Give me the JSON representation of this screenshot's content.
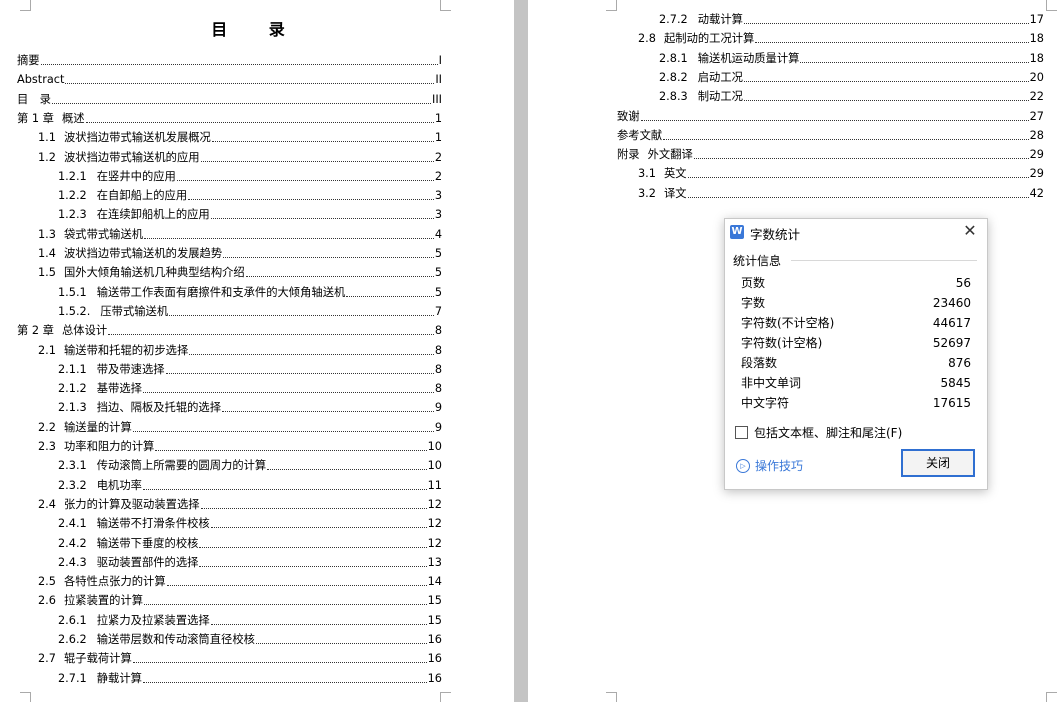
{
  "toc_title": "目 录",
  "left_entries": [
    {
      "num": "",
      "label": "摘要",
      "page": "I",
      "level": 0
    },
    {
      "num": "",
      "label": "Abstract",
      "page": "II",
      "level": 0
    },
    {
      "num": "",
      "label": "目　录",
      "page": "III",
      "level": 0
    },
    {
      "num": "第 1 章",
      "label": "概述",
      "page": "1",
      "level": 0
    },
    {
      "num": "1.1",
      "label": "波状挡边带式输送机发展概况",
      "page": "1",
      "level": 1
    },
    {
      "num": "1.2",
      "label": "波状挡边带式输送机的应用",
      "page": "2",
      "level": 1
    },
    {
      "num": "1.2.1",
      "label": "在竖井中的应用",
      "page": "2",
      "level": 2
    },
    {
      "num": "1.2.2",
      "label": "在自卸船上的应用",
      "page": "3",
      "level": 2
    },
    {
      "num": "1.2.3",
      "label": "在连续卸船机上的应用",
      "page": "3",
      "level": 2
    },
    {
      "num": "1.3",
      "label": "袋式带式输送机",
      "page": "4",
      "level": 1
    },
    {
      "num": "1.4",
      "label": "波状挡边带式输送机的发展趋势",
      "page": "5",
      "level": 1
    },
    {
      "num": "1.5",
      "label": "国外大倾角输送机几种典型结构介绍",
      "page": "5",
      "level": 1
    },
    {
      "num": "1.5.1",
      "label": "输送带工作表面有磨擦件和支承件的大倾角轴送机",
      "page": "5",
      "level": 2
    },
    {
      "num": "1.5.2.",
      "label": "压带式输送机",
      "page": "7",
      "level": 2
    },
    {
      "num": "第 2 章",
      "label": "总体设计",
      "page": "8",
      "level": 0
    },
    {
      "num": "2.1",
      "label": "输送带和托辊的初步选择",
      "page": "8",
      "level": 1
    },
    {
      "num": "2.1.1",
      "label": "带及带速选择",
      "page": "8",
      "level": 2
    },
    {
      "num": "2.1.2",
      "label": "基带选择",
      "page": "8",
      "level": 2
    },
    {
      "num": "2.1.3",
      "label": "挡边、隔板及托辊的选择",
      "page": "9",
      "level": 2
    },
    {
      "num": "2.2",
      "label": "输送量的计算",
      "page": "9",
      "level": 1
    },
    {
      "num": "2.3",
      "label": "功率和阻力的计算",
      "page": "10",
      "level": 1
    },
    {
      "num": "2.3.1",
      "label": "传动滚筒上所需要的圆周力的计算",
      "page": "10",
      "level": 2
    },
    {
      "num": "2.3.2",
      "label": "电机功率",
      "page": "11",
      "level": 2
    },
    {
      "num": "2.4",
      "label": "张力的计算及驱动装置选择",
      "page": "12",
      "level": 1
    },
    {
      "num": "2.4.1",
      "label": "输送带不打滑条件校核",
      "page": "12",
      "level": 2
    },
    {
      "num": "2.4.2",
      "label": "输送带下垂度的校核",
      "page": "12",
      "level": 2
    },
    {
      "num": "2.4.3",
      "label": "驱动装置部件的选择",
      "page": "13",
      "level": 2
    },
    {
      "num": "2.5",
      "label": "各特性点张力的计算",
      "page": "14",
      "level": 1
    },
    {
      "num": "2.6",
      "label": "拉紧装置的计算",
      "page": "15",
      "level": 1
    },
    {
      "num": "2.6.1",
      "label": "拉紧力及拉紧装置选择",
      "page": "15",
      "level": 2
    },
    {
      "num": "2.6.2",
      "label": "输送带层数和传动滚筒直径校核",
      "page": "16",
      "level": 2
    },
    {
      "num": "2.7",
      "label": "辊子载荷计算",
      "page": "16",
      "level": 1
    },
    {
      "num": "2.7.1",
      "label": "静载计算",
      "page": "16",
      "level": 2
    }
  ],
  "right_entries": [
    {
      "num": "2.7.2",
      "label": "动载计算",
      "page": "17",
      "level": 2
    },
    {
      "num": "2.8",
      "label": "起制动的工况计算",
      "page": "18",
      "level": 1
    },
    {
      "num": "2.8.1",
      "label": "输送机运动质量计算",
      "page": "18",
      "level": 2
    },
    {
      "num": "2.8.2",
      "label": "启动工况",
      "page": "20",
      "level": 2
    },
    {
      "num": "2.8.3",
      "label": "制动工况",
      "page": "22",
      "level": 2
    },
    {
      "num": "",
      "label": "致谢",
      "page": "27",
      "level": 0
    },
    {
      "num": "",
      "label": "参考文献",
      "page": "28",
      "level": 0
    },
    {
      "num": "附录",
      "label": "外文翻译",
      "page": "29",
      "level": 0
    },
    {
      "num": "3.1",
      "label": "英文",
      "page": "29",
      "level": 1
    },
    {
      "num": "3.2",
      "label": "译文",
      "page": "42",
      "level": 1
    }
  ],
  "dialog": {
    "logo": "W",
    "title": "字数统计",
    "group_label": "统计信息",
    "stats": [
      {
        "label": "页数",
        "value": "56"
      },
      {
        "label": "字数",
        "value": "23460"
      },
      {
        "label": "字符数(不计空格)",
        "value": "44617"
      },
      {
        "label": "字符数(计空格)",
        "value": "52697"
      },
      {
        "label": "段落数",
        "value": "876"
      },
      {
        "label": "非中文单词",
        "value": "5845"
      },
      {
        "label": "中文字符",
        "value": "17615"
      }
    ],
    "checkbox_label": "包括文本框、脚注和尾注(F)",
    "tips_label": "操作技巧",
    "close_label": "关闭",
    "close_glyph": "✕",
    "tips_glyph": "▷"
  }
}
